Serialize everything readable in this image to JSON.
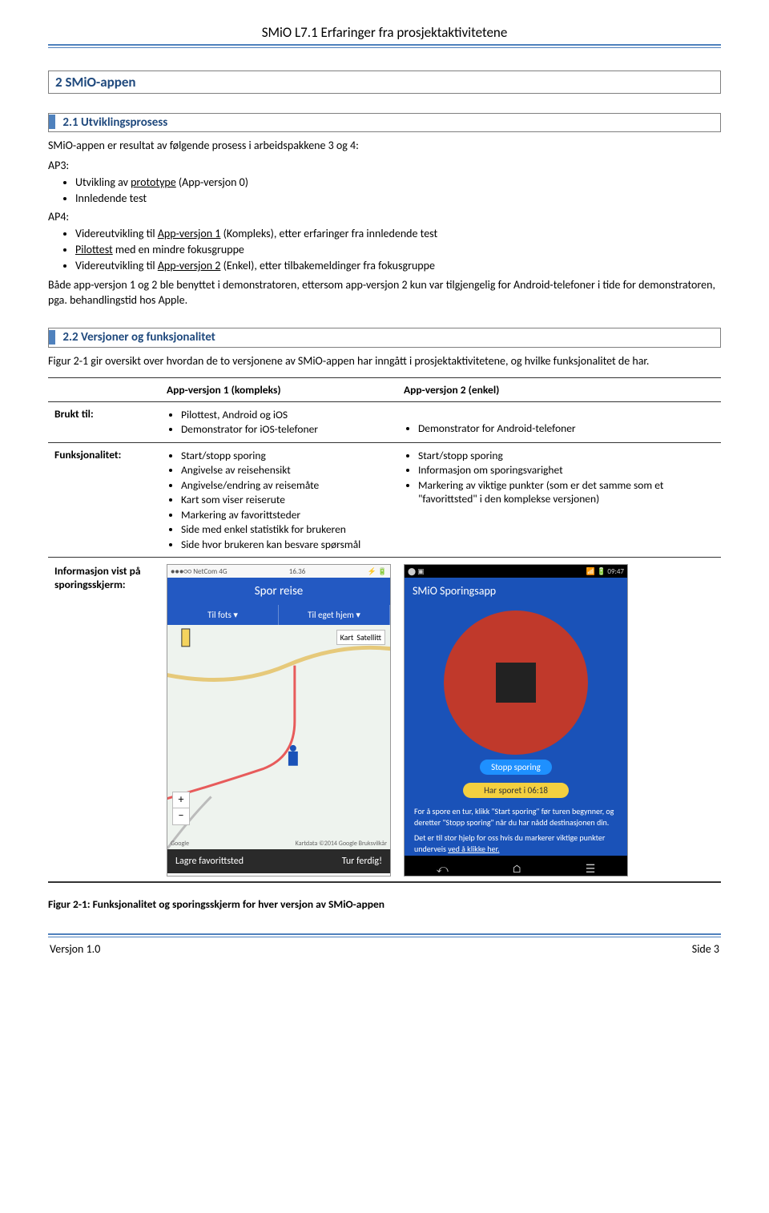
{
  "header": {
    "title": "SMiO L7.1 Erfaringer fra prosjektaktivitetene"
  },
  "section1": {
    "number_title": "2   SMiO-appen"
  },
  "section11": {
    "number_title": "2.1  Utviklingsprosess",
    "intro": "SMiO-appen er resultat av følgende prosess i arbeidspakkene 3 og 4:",
    "ap3_label": "AP3:",
    "ap3_items": [
      "Utvikling av <u>prototype</u> (App-versjon 0)",
      "Innledende test"
    ],
    "ap4_label": "AP4:",
    "ap4_items": [
      "Videreutvikling til <u>App-versjon 1</u> (Kompleks), etter erfaringer fra innledende test",
      "<u>Pilottest</u> med en mindre fokusgruppe",
      "Videreutvikling til <u>App-versjon 2</u> (Enkel), etter tilbakemeldinger fra fokusgruppe"
    ],
    "tail": "Både app-versjon 1 og 2 ble benyttet i demonstratoren, ettersom app-versjon 2 kun var tilgjengelig for Android-telefoner i tide for demonstratoren, pga. behandlingstid hos Apple."
  },
  "section22": {
    "number_title": "2.2  Versjoner og funksjonalitet",
    "intro": "Figur 2-1 gir oversikt over hvordan de to versjonene av SMiO-appen har inngått i prosjektaktivitetene, og hvilke funksjonalitet de har."
  },
  "table": {
    "col_headers": [
      "",
      "App-versjon 1 (kompleks)",
      "App-versjon 2 (enkel)"
    ],
    "rows": {
      "brukt": {
        "label": "Brukt til:",
        "v1": [
          "Pilottest, Android og iOS",
          "Demonstrator for iOS-telefoner"
        ],
        "v2": [
          "Demonstrator for Android-telefoner"
        ]
      },
      "funk": {
        "label": "Funksjonalitet:",
        "v1": [
          "Start/stopp sporing",
          "Angivelse av reisehensikt",
          "Angivelse/endring av reisemåte",
          "Kart som viser reiserute",
          "Markering av favorittsteder",
          "Side med enkel statistikk for brukeren",
          "Side hvor brukeren kan besvare spørsmål"
        ],
        "v2": [
          "Start/stopp sporing",
          "Informasjon om sporingsvarighet",
          "Markering av viktige punkter (som er det samme som et \"favorittsted\" i den komplekse versjonen)"
        ]
      },
      "info": {
        "label": "Informasjon vist på sporingsskjerm:"
      }
    }
  },
  "ios": {
    "status_left": "●●●○○ NetCom 4G",
    "status_time": "16.36",
    "status_right": "⚡ 🔋",
    "title": "Spor reise",
    "tab1": "Til fots   ▾",
    "tab2": "Til eget hjem ▾",
    "map_btn1": "Kart",
    "map_btn2": "Satellitt",
    "credit_left": "Google",
    "credit_right": "Kartdata ©2014 Google   Bruksvilkår",
    "bottom_left": "Lagre favorittsted",
    "bottom_right": "Tur ferdig!"
  },
  "android": {
    "status_right": "📶 🔋 09:47",
    "title": "SMiO Sporingsapp",
    "stop": "Stopp sporing",
    "duration": "Har sporet i 06:18",
    "info1": "For å spore en tur, klikk \"Start sporing\" før turen begynner, og deretter \"Stopp sporing\" når du har nådd destinasjonen din.",
    "info2_a": "Det er til stor hjelp for oss hvis du markerer viktige punkter underveis ",
    "info2_b": "ved å klikke her."
  },
  "caption": "Figur 2-1:   Funksjonalitet og sporingsskjerm for hver versjon av SMiO-appen",
  "footer": {
    "left": "Versjon 1.0",
    "right": "Side 3"
  }
}
